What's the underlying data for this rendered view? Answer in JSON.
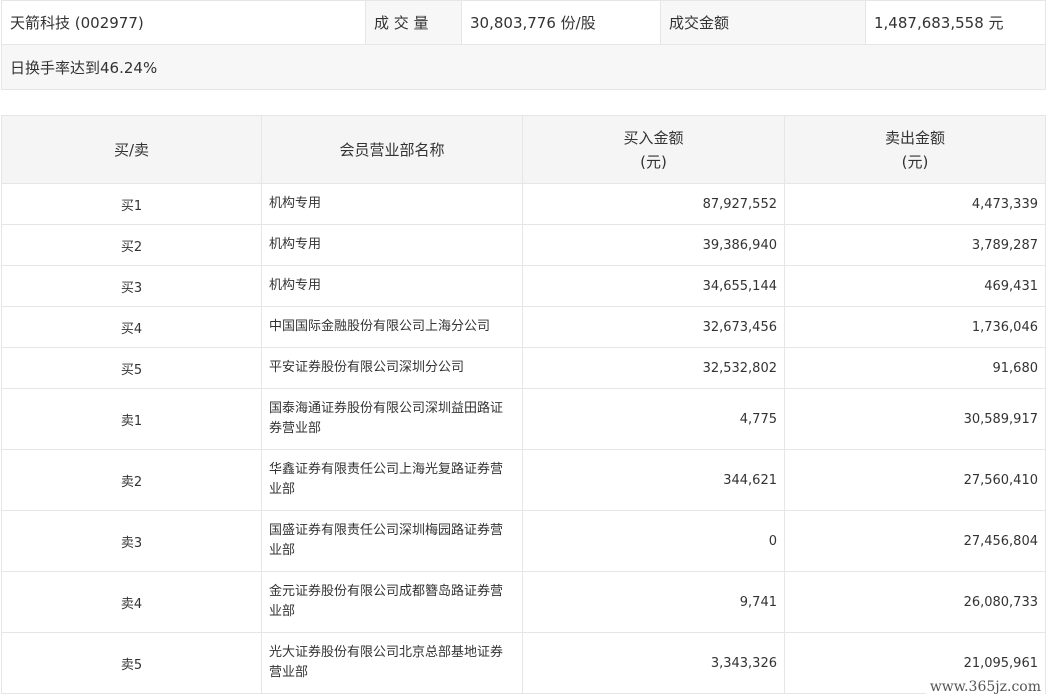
{
  "summary": {
    "stock": "天箭科技 (002977)",
    "volume_label": "成 交 量",
    "volume_value": "30,803,776 份/股",
    "amount_label": "成交金额",
    "amount_value": "1,487,683,558 元",
    "turnover": "日换手率达到46.24%"
  },
  "table": {
    "headers": {
      "side": "买/卖",
      "member": "会员营业部名称",
      "buy_line1": "买入金额",
      "buy_line2": "(元)",
      "sell_line1": "卖出金额",
      "sell_line2": "(元)"
    },
    "rows": [
      {
        "side": "买1",
        "member": "机构专用",
        "buy": "87,927,552",
        "sell": "4,473,339"
      },
      {
        "side": "买2",
        "member": "机构专用",
        "buy": "39,386,940",
        "sell": "3,789,287"
      },
      {
        "side": "买3",
        "member": "机构专用",
        "buy": "34,655,144",
        "sell": "469,431"
      },
      {
        "side": "买4",
        "member": "中国国际金融股份有限公司上海分公司",
        "buy": "32,673,456",
        "sell": "1,736,046"
      },
      {
        "side": "买5",
        "member": "平安证券股份有限公司深圳分公司",
        "buy": "32,532,802",
        "sell": "91,680"
      },
      {
        "side": "卖1",
        "member": "国泰海通证券股份有限公司深圳益田路证券营业部",
        "buy": "4,775",
        "sell": "30,589,917"
      },
      {
        "side": "卖2",
        "member": "华鑫证券有限责任公司上海光复路证券营业部",
        "buy": "344,621",
        "sell": "27,560,410"
      },
      {
        "side": "卖3",
        "member": "国盛证券有限责任公司深圳梅园路证券营业部",
        "buy": "0",
        "sell": "27,456,804"
      },
      {
        "side": "卖4",
        "member": "金元证券股份有限公司成都簪岛路证券营业部",
        "buy": "9,741",
        "sell": "26,080,733"
      },
      {
        "side": "卖5",
        "member": "光大证券股份有限公司北京总部基地证券营业部",
        "buy": "3,343,326",
        "sell": "21,095,961"
      }
    ]
  },
  "watermark": "www.365jz.com"
}
